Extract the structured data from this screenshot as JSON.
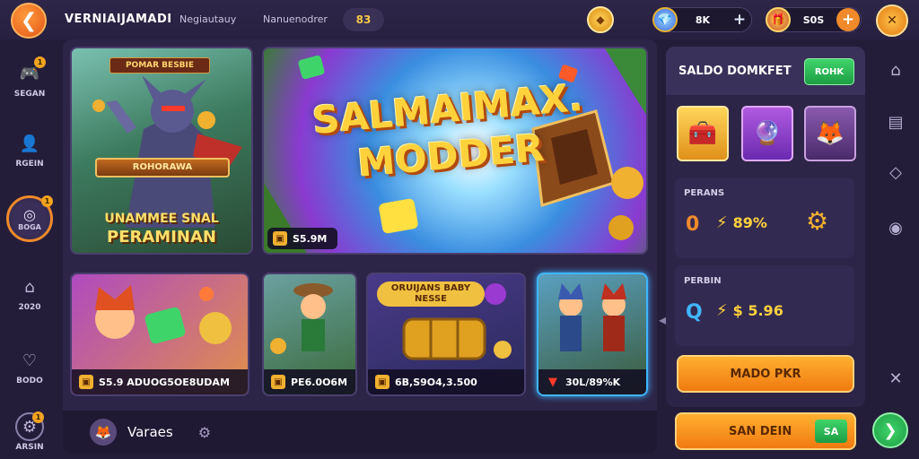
{
  "header": {
    "title": "VERNIAIJAMADI",
    "nav_links": [
      "Negiautauy",
      "Nanuenodrer"
    ],
    "count": "83"
  },
  "currencies": [
    {
      "value": "8K",
      "icon": "gem-icon"
    },
    {
      "value": "S0S",
      "icon": "coin-chest-icon"
    }
  ],
  "left_nav": [
    {
      "label": "SEGAN",
      "icon": "game-controller-icon",
      "badge": "1"
    },
    {
      "label": "RGEIN",
      "icon": "user-icon",
      "badge": ""
    },
    {
      "label": "BOGA",
      "icon": "target-icon",
      "badge": "1",
      "active": true
    },
    {
      "label": "2020",
      "icon": "home-icon",
      "badge": ""
    },
    {
      "label": "BODO",
      "icon": "heart-icon",
      "badge": ""
    },
    {
      "label": "ARSIN",
      "icon": "settings-icon",
      "badge": "1"
    }
  ],
  "hero_card": {
    "badge": "POMAR BESBIE",
    "sign": "ROHORAWA",
    "line1": "UNAMMEE SNAL",
    "line2": "PERAMINAN"
  },
  "banner": {
    "title_line1": "SALMAIMAX.",
    "title_line2": "MODDER",
    "price": "S5.9M"
  },
  "game_cards": [
    {
      "price": "S5.9 ADUOG5OE8UDAM"
    },
    {
      "price": "PE6.0O6M"
    },
    {
      "price": "6B,S9O4,3.500",
      "banner": "ORUIJANS BABY NESSE"
    },
    {
      "price": "30L/89%K"
    }
  ],
  "bottom_bar": {
    "label": "Varaes"
  },
  "side_panel": {
    "title": "SALDO DOMKFET",
    "ok_label": "ROHK",
    "section1": {
      "label": "PERANS",
      "stat1": "0",
      "stat2": "89%"
    },
    "section2": {
      "label": "PERBIN",
      "stat1": "Q",
      "stat2": "$ 5.96"
    },
    "primary_button": "MADO PKR",
    "secondary_button": "SAN DEIN",
    "secondary_button_tag": "SA"
  },
  "colors": {
    "accent_orange": "#f08a2a",
    "accent_blue": "#3fb6ff",
    "gold": "#ffd23c",
    "panel": "#2d2547"
  }
}
